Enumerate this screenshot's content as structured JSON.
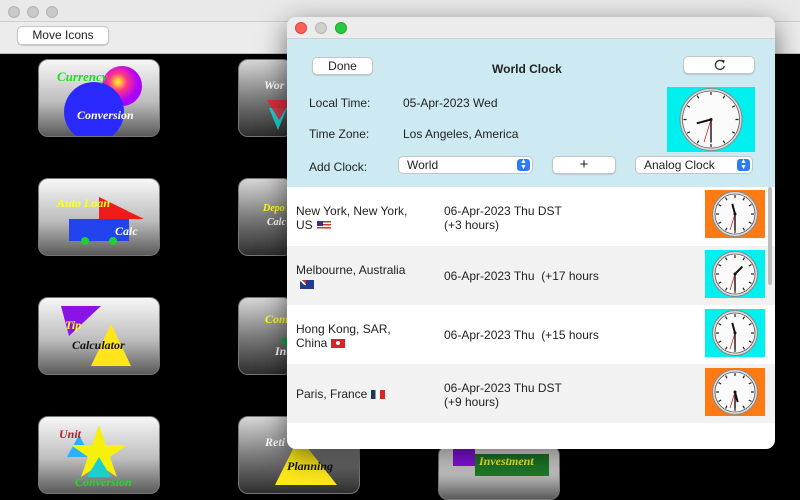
{
  "background_app": {
    "move_icons_label": "Move Icons",
    "tiles": [
      {
        "line1": "Currency",
        "line2": "Conversion"
      },
      {
        "line1": "Wor",
        "line2": ""
      },
      {
        "line1": "Auto Loan",
        "line2": "Calc"
      },
      {
        "line1": "Depo",
        "line2": "Calc"
      },
      {
        "line1": "Tip",
        "line2": "Calculator"
      },
      {
        "line1": "Com",
        "line2": "Int"
      },
      {
        "line1": "Unit",
        "line2": "Conversion"
      },
      {
        "line1": "Reti",
        "line2": "Planning"
      },
      {
        "line1": "Investment",
        "line2": ""
      }
    ]
  },
  "world_clock": {
    "title": "World Clock",
    "done_label": "Done",
    "refresh_icon": "refresh-icon",
    "local_time_label": "Local Time:",
    "local_time_value": "05-Apr-2023 Wed",
    "time_zone_label": "Time Zone:",
    "time_zone_value": "Los Angeles, America",
    "add_clock_label": "Add Clock:",
    "region_select": "World",
    "add_button": "+",
    "clock_style_select": "Analog Clock",
    "colors": {
      "header": "#cdeaf3",
      "cyan": "#00f0f0",
      "orange": "#ff7a12",
      "accent": "#2f7bf5"
    },
    "clocks": [
      {
        "city": "New York, New York, US",
        "date": "06-Apr-2023 Thu DST",
        "offset": "(+3 hours)",
        "flag": "us-flag"
      },
      {
        "city": "Melbourne, Australia",
        "date": "06-Apr-2023 Thu",
        "offset": "(+17 hours",
        "flag": "australia-flag"
      },
      {
        "city": "Hong Kong, SAR, China",
        "date": "06-Apr-2023 Thu",
        "offset": "(+15 hours",
        "flag": "hong-kong-flag"
      },
      {
        "city": "Paris, France",
        "date": "06-Apr-2023 Thu DST",
        "offset": "(+9 hours)",
        "flag": "france-flag"
      }
    ]
  }
}
